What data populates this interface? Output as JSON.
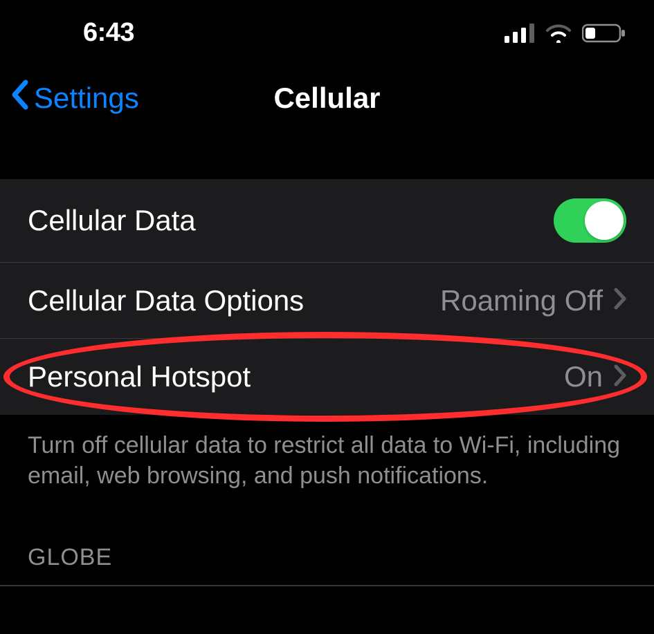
{
  "status_bar": {
    "time": "6:43"
  },
  "nav": {
    "back_label": "Settings",
    "title": "Cellular"
  },
  "rows": {
    "cellular_data": {
      "label": "Cellular Data",
      "toggle": "on"
    },
    "cellular_data_options": {
      "label": "Cellular Data Options",
      "value": "Roaming Off"
    },
    "personal_hotspot": {
      "label": "Personal Hotspot",
      "value": "On"
    }
  },
  "footer_text": "Turn off cellular data to restrict all data to Wi-Fi, including email, web browsing, and push notifications.",
  "carrier_header": "GLOBE",
  "colors": {
    "accent_link": "#0a84ff",
    "toggle_on": "#30d158",
    "annotation": "#ff2d2d"
  }
}
